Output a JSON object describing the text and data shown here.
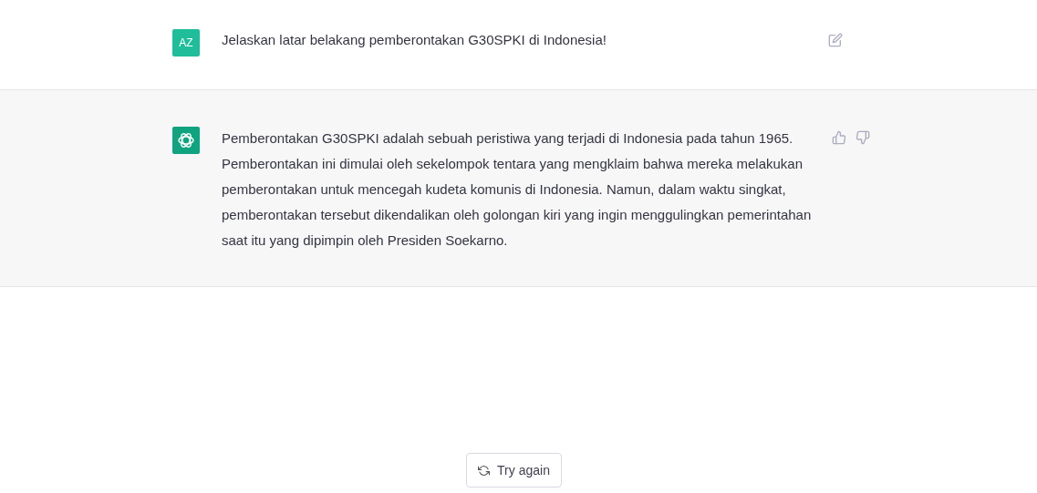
{
  "messages": [
    {
      "kind": "user",
      "avatar": "AZ",
      "text": "Jelaskan latar belakang pemberontakan G30SPKI di Indonesia!"
    },
    {
      "kind": "assistant",
      "text": "Pemberontakan G30SPKI adalah sebuah peristiwa yang terjadi di Indonesia pada tahun 1965. Pemberontakan ini dimulai oleh sekelompok tentara yang mengklaim bahwa mereka melakukan pemberontakan untuk mencegah kudeta komunis di Indonesia. Namun, dalam waktu singkat, pemberontakan tersebut dikendalikan oleh golongan kiri yang ingin menggulingkan pemerintahan saat itu yang dipimpin oleh Presiden Soekarno."
    }
  ],
  "retry_button": {
    "label": "Try again"
  }
}
